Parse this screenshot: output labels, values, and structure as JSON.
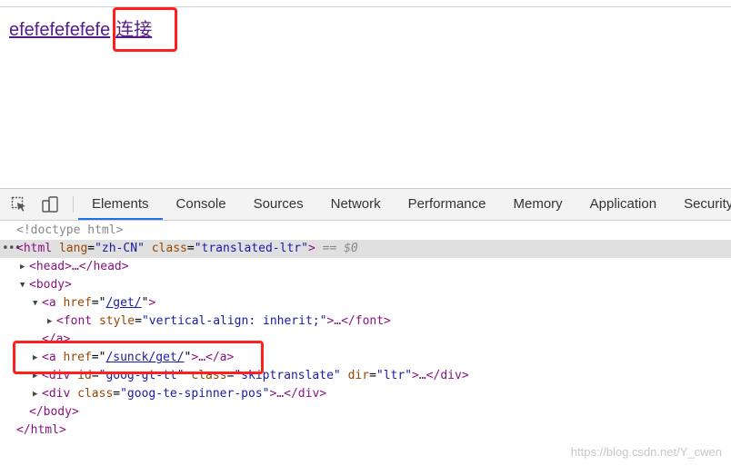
{
  "page": {
    "link1_text": "efefefefefefe",
    "link2_text": "连接"
  },
  "devtools": {
    "tabs": [
      {
        "label": "Elements",
        "active": true
      },
      {
        "label": "Console"
      },
      {
        "label": "Sources"
      },
      {
        "label": "Network"
      },
      {
        "label": "Performance"
      },
      {
        "label": "Memory"
      },
      {
        "label": "Application"
      },
      {
        "label": "Security"
      }
    ],
    "tree": {
      "doctype": "<!doctype html>",
      "html_open_tag": "<html",
      "html_lang_attr": "lang",
      "html_lang_val": "\"zh-CN\"",
      "html_class_attr": "class",
      "html_class_val": "\"translated-ltr\"",
      "html_selected_marker": "== ",
      "html_selected_var": "$0",
      "head": "<head>…</head>",
      "body_open": "<body>",
      "a1_open": "<a",
      "a1_href_attr": "href",
      "a1_href_val": "/get/",
      "font_open": "<font",
      "font_style_attr": "style",
      "font_style_val": "\"vertical-align: inherit;\"",
      "font_close": ">…</font>",
      "a1_close": "</a>",
      "a2_open": "<a",
      "a2_href_attr": "href",
      "a2_href_val": "/sunck/get/",
      "a2_close": ">…</a>",
      "div1_open": "<div",
      "div1_id_attr": "id",
      "div1_id_val": "\"goog-gt-tt\"",
      "div1_class_attr": "class",
      "div1_class_val": "\"skiptranslate\"",
      "div1_dir_attr": "dir",
      "div1_dir_val": "\"ltr\"",
      "div1_close": ">…</div>",
      "div2_open": "<div",
      "div2_class_attr": "class",
      "div2_class_val": "\"goog-te-spinner-pos\"",
      "div2_close": ">…</div>",
      "body_close": "</body>",
      "html_close": "</html>"
    }
  },
  "watermark": "https://blog.csdn.net/Y_cwen",
  "colors": {
    "highlight_box": "#ff1f1f",
    "link_visited": "#551a8b",
    "tab_active_underline": "#1a73e8",
    "tag": "#881280",
    "attr": "#994500",
    "value": "#1a1aa6"
  }
}
